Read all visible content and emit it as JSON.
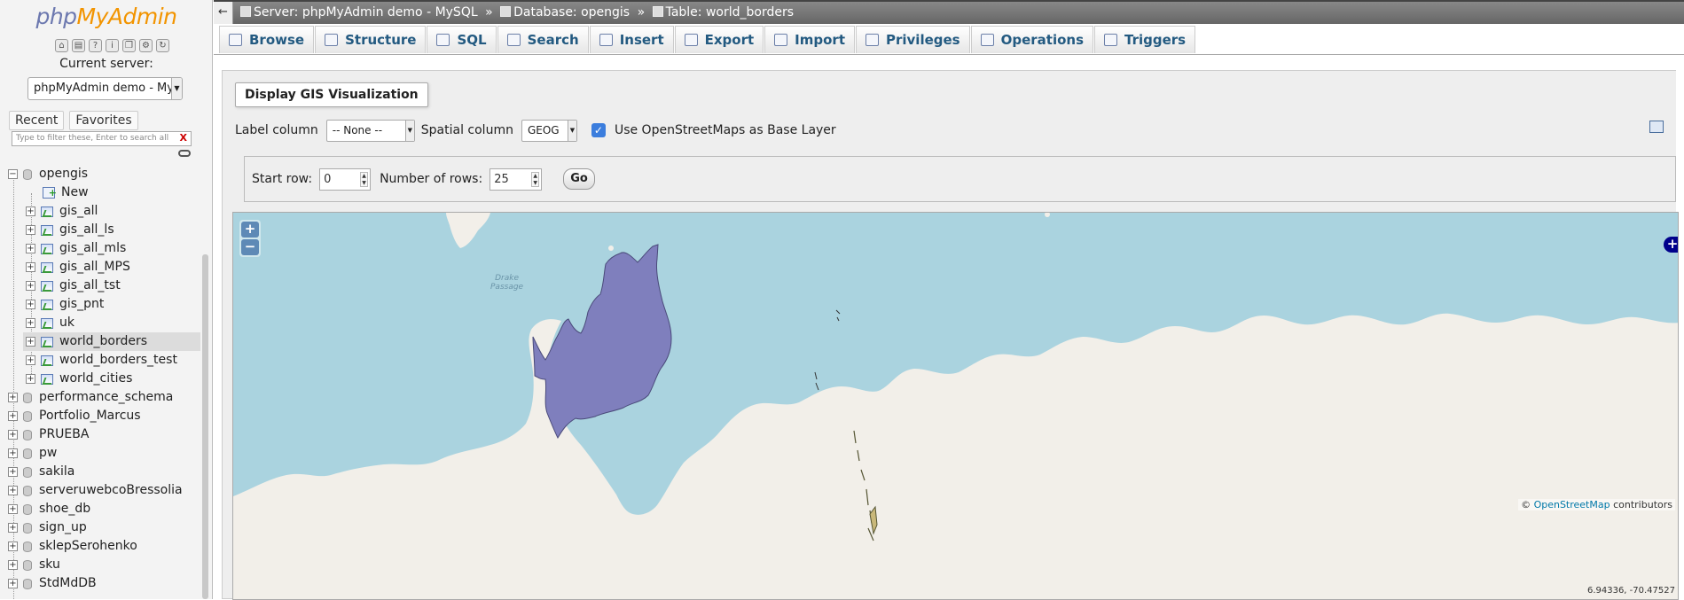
{
  "nav": {
    "logo_php": "php",
    "logo_myadmin": "MyAdmin",
    "current_server_label": "Current server:",
    "server_select_value": "phpMyAdmin demo - MySQL",
    "tabs": [
      "Recent",
      "Favorites"
    ],
    "filter_placeholder": "Type to filter these, Enter to search all",
    "filter_clear": "X",
    "tree": {
      "open_db": "opengis",
      "new_label": "New",
      "tables": [
        "gis_all",
        "gis_all_ls",
        "gis_all_mls",
        "gis_all_MPS",
        "gis_all_tst",
        "gis_pnt",
        "uk",
        "world_borders",
        "world_borders_test",
        "world_cities"
      ],
      "selected_table": "world_borders",
      "other_dbs": [
        "performance_schema",
        "Portfolio_Marcus",
        "PRUEBA",
        "pw",
        "sakila",
        "serveruwebcoBressolia",
        "shoe_db",
        "sign_up",
        "sklepSerohenko",
        "sku",
        "StdMdDB"
      ]
    }
  },
  "breadcrumb": {
    "back": "←",
    "server": "Server: phpMyAdmin demo - MySQL",
    "database": "Database: opengis",
    "table": "Table: world_borders",
    "separator": "»"
  },
  "menu_tabs": [
    {
      "label": "Browse",
      "icon": "browse-icon"
    },
    {
      "label": "Structure",
      "icon": "structure-icon"
    },
    {
      "label": "SQL",
      "icon": "sql-icon"
    },
    {
      "label": "Search",
      "icon": "search-icon"
    },
    {
      "label": "Insert",
      "icon": "insert-icon"
    },
    {
      "label": "Export",
      "icon": "export-icon"
    },
    {
      "label": "Import",
      "icon": "import-icon"
    },
    {
      "label": "Privileges",
      "icon": "privileges-icon"
    },
    {
      "label": "Operations",
      "icon": "wrench-icon"
    },
    {
      "label": "Triggers",
      "icon": "triggers-icon"
    }
  ],
  "gis": {
    "legend": "Display GIS Visualization",
    "label_column_label": "Label column",
    "label_column_value": "-- None --",
    "spatial_column_label": "Spatial column",
    "spatial_column_value": "GEOG",
    "osm_checkbox_label": "Use OpenStreetMaps as Base Layer",
    "osm_checked": true,
    "start_row_label": "Start row:",
    "start_row_value": "0",
    "num_rows_label": "Number of rows:",
    "num_rows_value": "25",
    "go_label": "Go"
  },
  "map": {
    "zoom_in": "+",
    "zoom_out": "−",
    "layer_switch": "+",
    "place_label_line1": "Drake",
    "place_label_line2": "Passage",
    "attribution_prefix": "©",
    "attribution_link": "OpenStreetMap",
    "attribution_suffix": "contributors",
    "coordinates": "6.94336, -70.47527",
    "colors": {
      "water": "#aad3df",
      "land": "#f2efe9",
      "polygon_fill": "#7f7fbd",
      "polygon_stroke": "#4a4a7a"
    }
  }
}
